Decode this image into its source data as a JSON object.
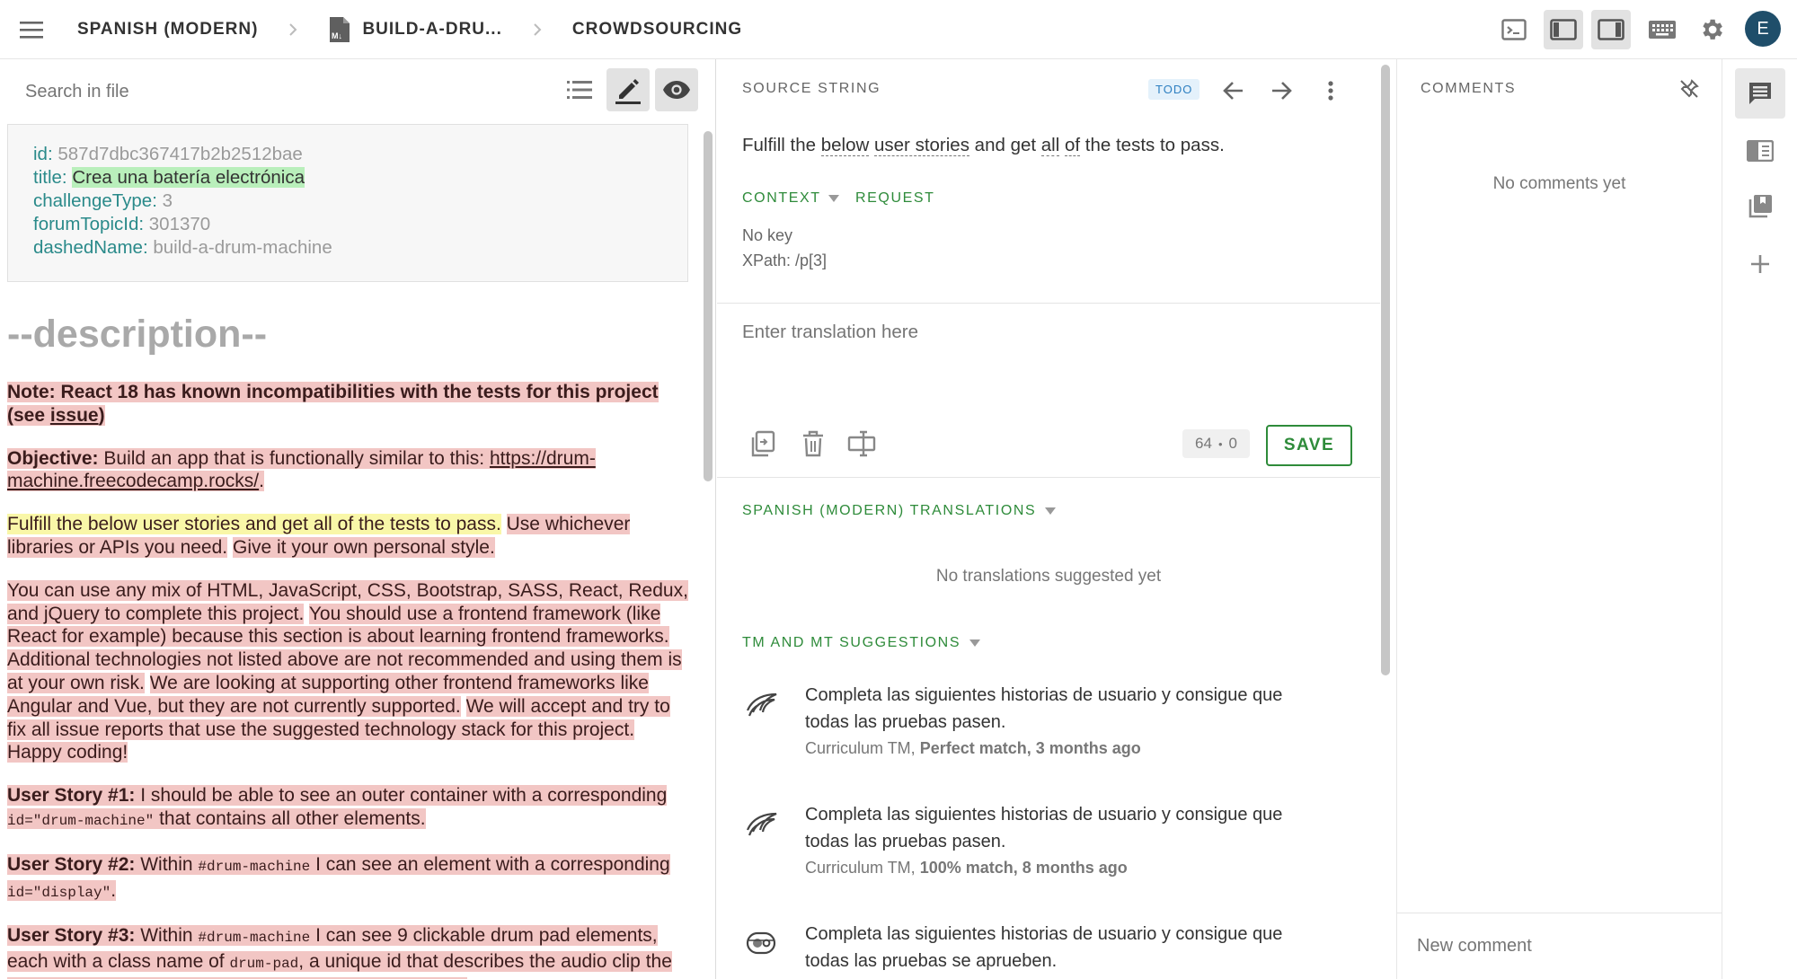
{
  "breadcrumb": {
    "project": "SPANISH (MODERN)",
    "file": "BUILD-A-DRU...",
    "workspace": "CROWDSOURCING"
  },
  "user": {
    "avatar_letter": "E",
    "avatar_color": "#1f4e6a"
  },
  "icons": {
    "menu": "hamburger-icon",
    "file": "markdown-file-icon",
    "terminal": "terminal-icon",
    "left_panel": "left-panel-icon",
    "right_panel": "right-panel-icon",
    "keyboard": "keyboard-icon",
    "settings": "gear-icon"
  },
  "left": {
    "search_placeholder": "Search in file",
    "front_matter": [
      {
        "key": "id:",
        "value": "587d7dbc367417b2b2512bae"
      },
      {
        "key": "title:",
        "value": "Crea una batería electrónica"
      },
      {
        "key": "challengeType:",
        "value": "3"
      },
      {
        "key": "forumTopicId:",
        "value": "301370"
      },
      {
        "key": "dashedName:",
        "value": "build-a-drum-machine"
      }
    ],
    "description_heading": "--description--",
    "note": {
      "prefix": "Note: React 18 has known incompatibilities with the tests for this project (see ",
      "link": "issue",
      "suffix": ")"
    },
    "objective": {
      "label": "Objective:",
      "text": " Build an app that is functionally similar to this: ",
      "link": "https://drum-machine.freecodecamp.rocks/",
      "end": "."
    },
    "fulfill": {
      "highlighted": "Fulfill the below user stories and get all of the tests to pass.",
      "s2": "Use whichever libraries or APIs you need.",
      "s3": "Give it your own personal style."
    },
    "tech": {
      "s1": "You can use any mix of HTML, JavaScript, CSS, Bootstrap, SASS, React, Redux, and jQuery to complete this project.",
      "s2": "You should use a frontend framework (like React for example) because this section is about learning frontend frameworks.",
      "s3": "Additional technologies not listed above are not recommended and using them is at your own risk.",
      "s4": "We are looking at supporting other frontend frameworks like Angular and Vue, but they are not currently supported.",
      "s5": "We will accept and try to fix all issue reports that use the suggested technology stack for this project.",
      "s6": "Happy coding!"
    },
    "story1": {
      "label": "User Story #1:",
      "a": " I should be able to see an outer container with a corresponding ",
      "code": "id=\"drum-machine\"",
      "b": " that contains all other elements."
    },
    "story2": {
      "label": "User Story #2:",
      "a": " Within ",
      "code1": "#drum-machine",
      "b": " I can see an element with a corresponding ",
      "code2": "id=\"display\"",
      "c": "."
    },
    "story3": {
      "label": "User Story #3:",
      "a": " Within ",
      "code1": "#drum-machine",
      "b": " I can see 9 clickable drum pad elements, each with a class name of ",
      "code2": "drum-pad",
      "c": ", a unique id that describes the audio clip the drum pad will be set up to trigger, and an inner text that"
    }
  },
  "middle": {
    "source_label": "SOURCE STRING",
    "status_badge": "TODO",
    "source_text": {
      "w1": "Fulfill the ",
      "w2": "below",
      "w3": " ",
      "w4": "user stories",
      "w5": " and get ",
      "w6": "all",
      "w7": " ",
      "w8": "of",
      "w9": " the tests to pass."
    },
    "context_tab": "CONTEXT",
    "request_tab": "REQUEST",
    "context_key": "No key",
    "context_xpath": "XPath: /p[3]",
    "translation_placeholder": "Enter translation here",
    "counter_chars": "64",
    "counter_dot": "•",
    "counter_errors": "0",
    "save_label": "SAVE",
    "translations_label": "SPANISH (MODERN) TRANSLATIONS",
    "no_translations": "No translations suggested yet",
    "suggestions_label": "TM AND MT SUGGESTIONS",
    "suggestions": [
      {
        "text": "Completa las siguientes historias de usuario y consigue que todas las pruebas pasen.",
        "source": "Curriculum TM, ",
        "match": "Perfect match, 3 months ago"
      },
      {
        "text": "Completa las siguientes historias de usuario y consigue que todas las pruebas pasen.",
        "source": "Curriculum TM, ",
        "match": "100% match, 8 months ago"
      },
      {
        "text": "Completa las siguientes historias de usuario y consigue que todas las pruebas se aprueben.",
        "source": "",
        "match": ""
      }
    ],
    "accent": "#2e8b3a"
  },
  "comments": {
    "label": "COMMENTS",
    "empty": "No comments yet",
    "new_placeholder": "New comment"
  }
}
